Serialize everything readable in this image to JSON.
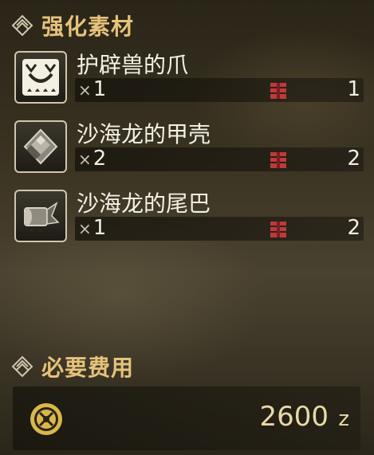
{
  "materials_section": {
    "title": "强化素材",
    "items": [
      {
        "name": "护辟兽的爪",
        "qty_prefix": "×",
        "qty": "1",
        "owned": "1",
        "icon": "claw-icon"
      },
      {
        "name": "沙海龙的甲壳",
        "qty_prefix": "×",
        "qty": "2",
        "owned": "2",
        "icon": "shell-icon"
      },
      {
        "name": "沙海龙的尾巴",
        "qty_prefix": "×",
        "qty": "1",
        "owned": "2",
        "icon": "tail-icon"
      }
    ]
  },
  "cost_section": {
    "title": "必要费用",
    "amount": "2600",
    "unit": "z"
  },
  "colors": {
    "header_gold": "#e6c27a",
    "item_box_red": "#c0393b",
    "coin_gold": "#d9b84a"
  }
}
